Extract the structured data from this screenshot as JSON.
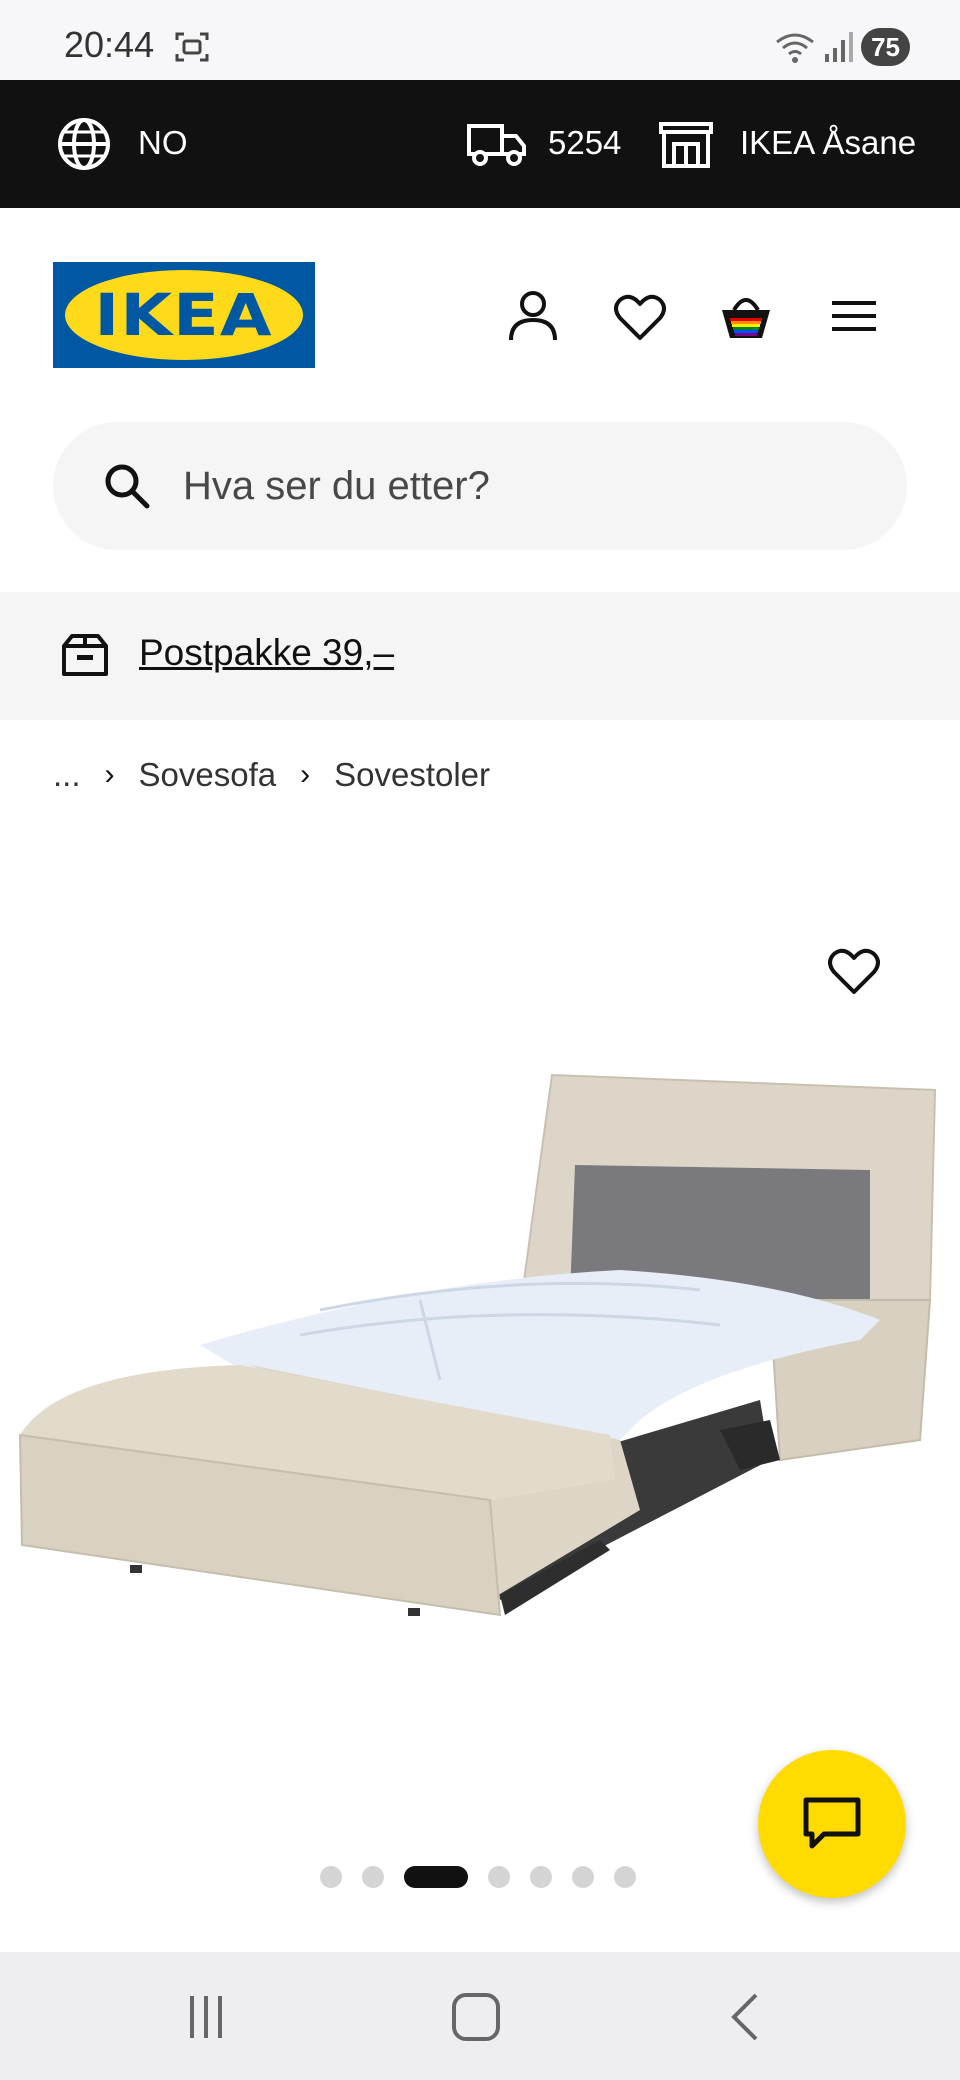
{
  "status_bar": {
    "time": "20:44",
    "battery": "75"
  },
  "top_bar": {
    "language": "NO",
    "postal_code": "5254",
    "store": "IKEA Åsane"
  },
  "header": {
    "logo_text": "IKEA"
  },
  "search": {
    "placeholder": "Hva ser du etter?"
  },
  "promo": {
    "label": "Postpakke 39,–"
  },
  "breadcrumb": {
    "items": [
      "...",
      "Sovesofa",
      "Sovestoler"
    ]
  },
  "carousel": {
    "total": 7,
    "active_index": 2
  },
  "colors": {
    "ikea_blue": "#0058a3",
    "ikea_yellow": "#ffda1a",
    "chat_yellow": "#ffdb00",
    "topbar_bg": "#111111"
  }
}
